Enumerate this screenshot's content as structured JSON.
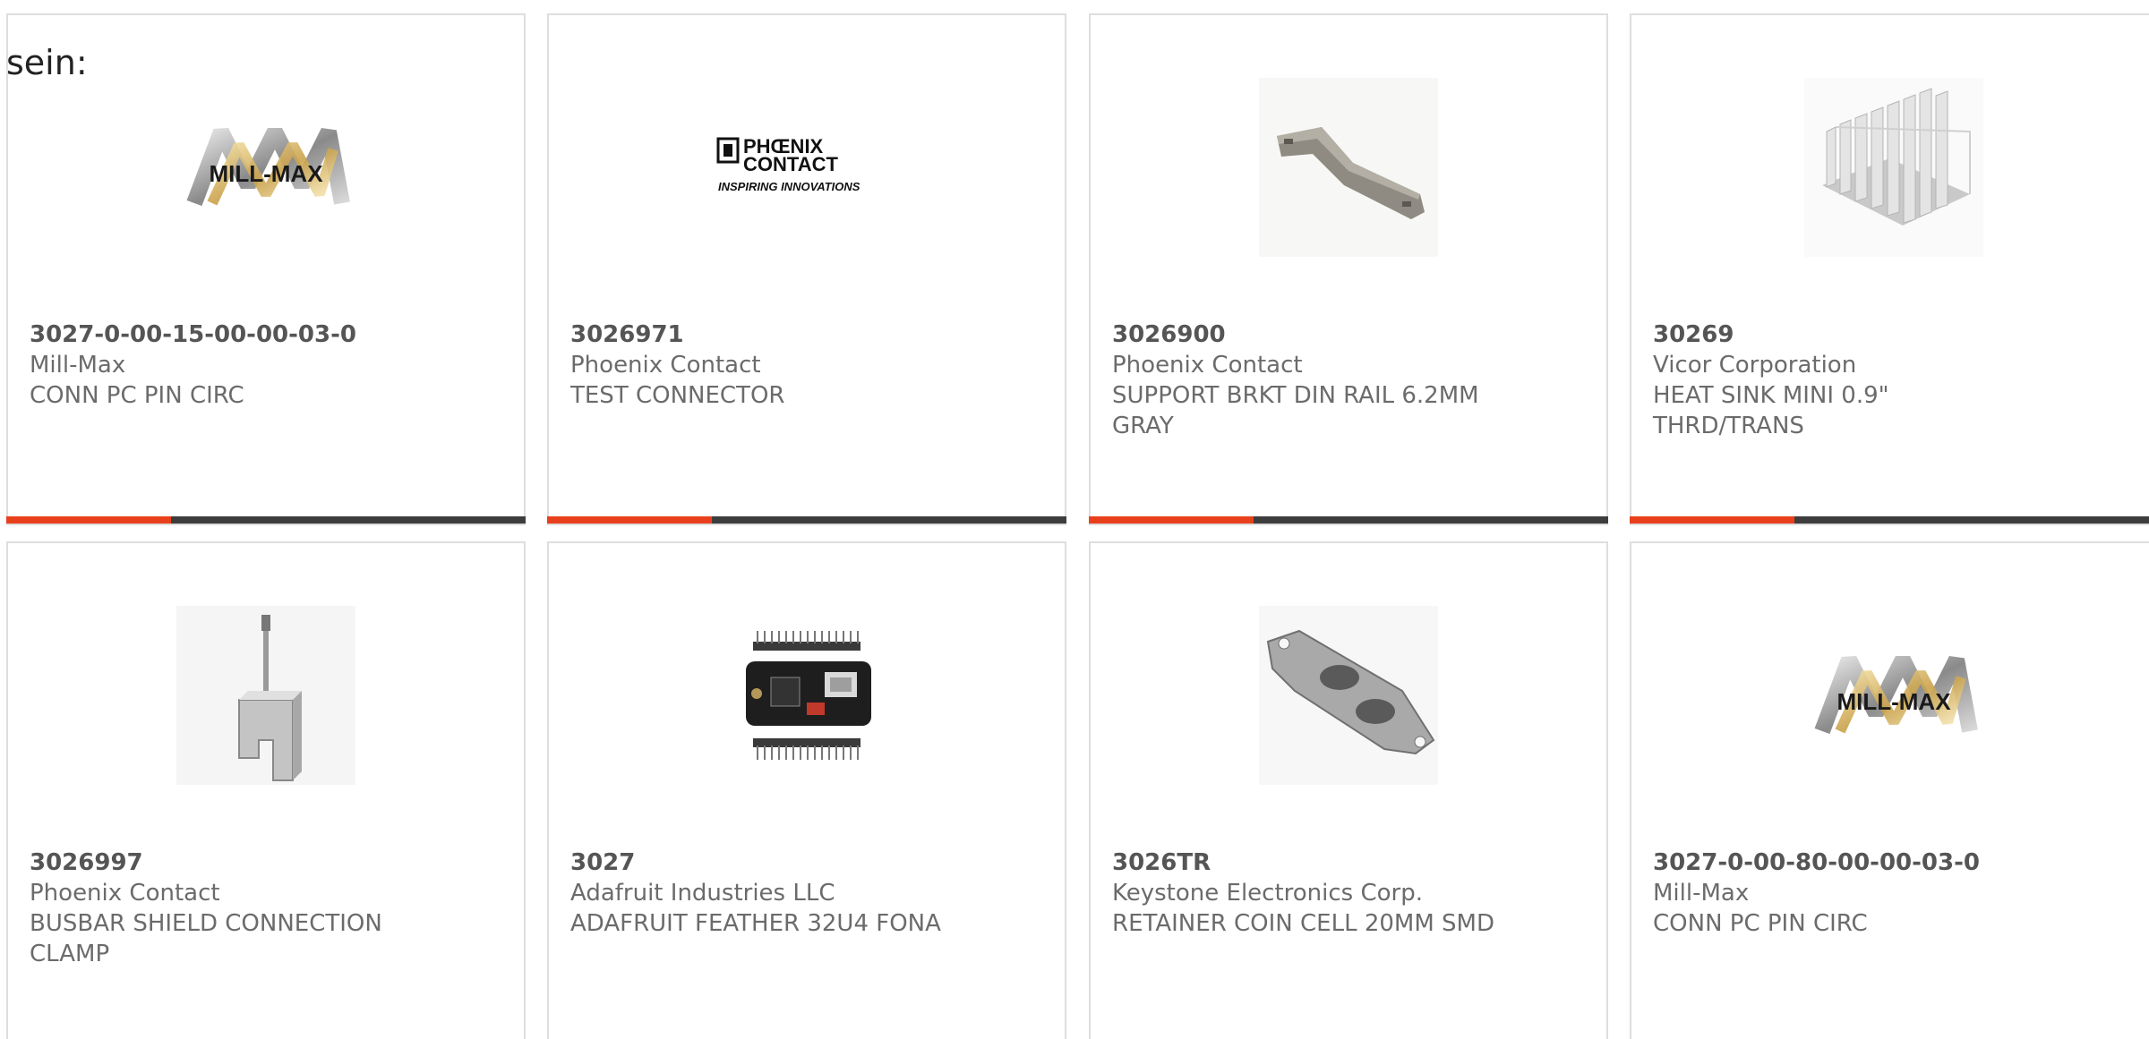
{
  "lead_text": "sein:",
  "cards": [
    {
      "part_number": "3027-0-00-15-00-00-03-0",
      "manufacturer": "Mill-Max",
      "description": "CONN PC PIN CIRC",
      "image": "mill-max-logo",
      "logo_text": "MILL-MAX"
    },
    {
      "part_number": "3026971",
      "manufacturer": "Phoenix Contact",
      "description": "TEST CONNECTOR",
      "image": "phoenix-contact-logo",
      "logo_line1": "PHŒNIX",
      "logo_line2": "CONTACT",
      "logo_tagline": "INSPIRING INNOVATIONS"
    },
    {
      "part_number": "3026900",
      "manufacturer": "Phoenix Contact",
      "description": "SUPPORT BRKT DIN RAIL 6.2MM GRAY",
      "image": "din-rail-bracket"
    },
    {
      "part_number": "30269",
      "manufacturer": "Vicor Corporation",
      "description": "HEAT SINK MINI 0.9\" THRD/TRANS",
      "image": "heat-sink"
    },
    {
      "part_number": "3026997",
      "manufacturer": "Phoenix Contact",
      "description": "BUSBAR SHIELD CONNECTION CLAMP",
      "image": "busbar-clamp"
    },
    {
      "part_number": "3027",
      "manufacturer": "Adafruit Industries LLC",
      "description": "ADAFRUIT FEATHER 32U4 FONA",
      "image": "feather-board"
    },
    {
      "part_number": "3026TR",
      "manufacturer": "Keystone Electronics Corp.",
      "description": "RETAINER COIN CELL 20MM SMD",
      "image": "coin-cell-retainer"
    },
    {
      "part_number": "3027-0-00-80-00-00-03-0",
      "manufacturer": "Mill-Max",
      "description": "CONN PC PIN CIRC",
      "image": "mill-max-logo",
      "logo_text": "MILL-MAX"
    }
  ],
  "colors": {
    "accent": "#e8401c",
    "bar_dark": "#3d3d3d",
    "border": "#dedede",
    "text": "#6b6b6b"
  }
}
